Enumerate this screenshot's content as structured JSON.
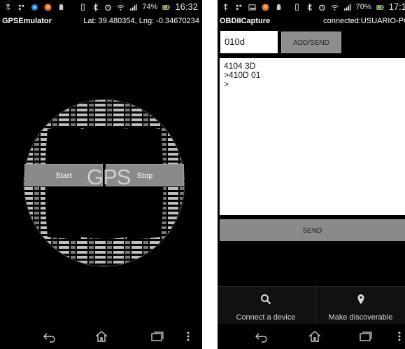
{
  "left_screen": {
    "status": {
      "battery_pct": "74%",
      "time": "16:32"
    },
    "title": "GPSEmulator",
    "location": "Lat: 39.480354, Lng: -0.34670234",
    "watermark": "GPS",
    "start_label": "Start",
    "stop_label": "Stop",
    "icons": {
      "usb": "usb-icon",
      "notification": "notification-icon",
      "location": "location-icon",
      "avatar": "app-avatar-icon",
      "android": "android-icon",
      "vibrate": "vibrate-icon",
      "bluetooth": "bluetooth-icon",
      "alarm": "alarm-icon",
      "wifi": "wifi-icon",
      "signal": "signal-icon",
      "battery": "battery-icon",
      "back": "back-icon",
      "home": "home-icon",
      "recents": "recents-icon",
      "menu": "overflow-menu-icon",
      "globe": "word-cloud-globe-icon"
    }
  },
  "right_screen": {
    "status": {
      "battery_pct": "70%",
      "time": "17:1"
    },
    "title": "OBDIICapture",
    "connection": "connected:USUARIO-PC",
    "command_value": "010d",
    "add_send_label": "ADD/SEND",
    "console_lines": [
      "4104 3D",
      ">410D 01",
      ">"
    ],
    "send_label": "SEND",
    "connect_label": "Connect a device",
    "discover_label": "Make discoverable",
    "icons": {
      "search": "search-icon",
      "pin": "location-pin-icon"
    }
  },
  "colors": {
    "background": "#000000",
    "button_gray": "#8a8a8a",
    "text_white": "#ffffff",
    "console_bg": "#ffffff"
  }
}
